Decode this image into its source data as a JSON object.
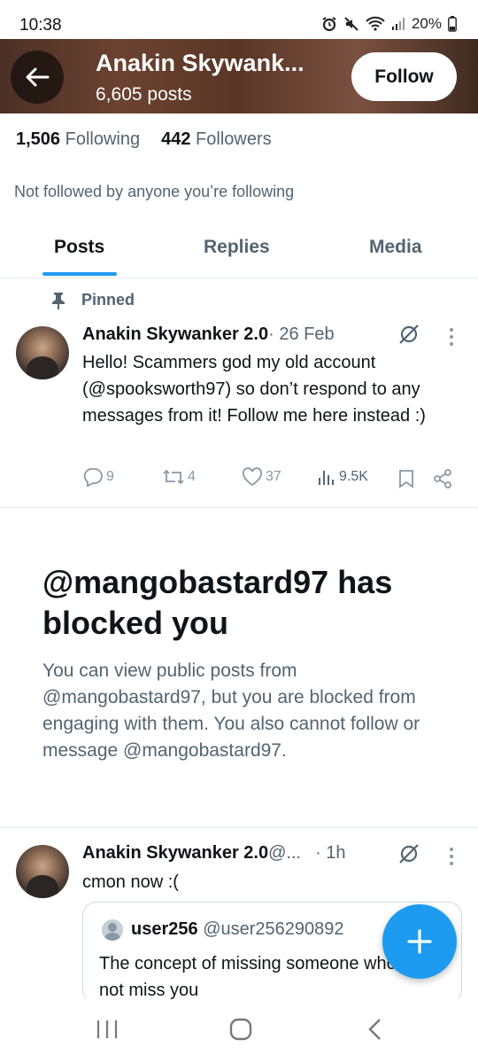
{
  "status_bar": {
    "time": "10:38",
    "battery": "20%"
  },
  "header": {
    "name": "Anakin Skywank...",
    "posts": "6,605 posts",
    "follow_label": "Follow"
  },
  "stats": {
    "following_count": "1,506",
    "following_label": "Following",
    "followers_count": "442",
    "followers_label": "Followers"
  },
  "not_followed_text": "Not followed by anyone you’re following",
  "tabs": [
    {
      "label": "Posts",
      "active": true
    },
    {
      "label": "Replies",
      "active": false
    },
    {
      "label": "Media",
      "active": false
    }
  ],
  "pinned_tweet": {
    "pinned_label": "Pinned",
    "name": "Anakin Skywanker 2.0",
    "meta": " · 26 Feb",
    "text": "Hello! Scammers god my old account (@spooksworth97) so don’t respond to any messages from it! Follow me here instead :)",
    "replies": "9",
    "reposts": "4",
    "likes": "37",
    "views": "9.5K"
  },
  "blocked": {
    "title": "@mangobastard97 has blocked you",
    "text": "You can view public posts from @mangobastard97, but you are blocked from engaging with them. You also cannot follow or message @mangobastard97."
  },
  "tweet2": {
    "name": "Anakin Skywanker 2.0",
    "handle": " @...",
    "time": " · 1h",
    "text": "cmon now :("
  },
  "quoted": {
    "name": "user256",
    "handle": " @user256290892",
    "text": "The concept of missing someone who does not miss you"
  },
  "colors": {
    "accent": "#1d9bf0",
    "text_secondary": "#536471"
  }
}
